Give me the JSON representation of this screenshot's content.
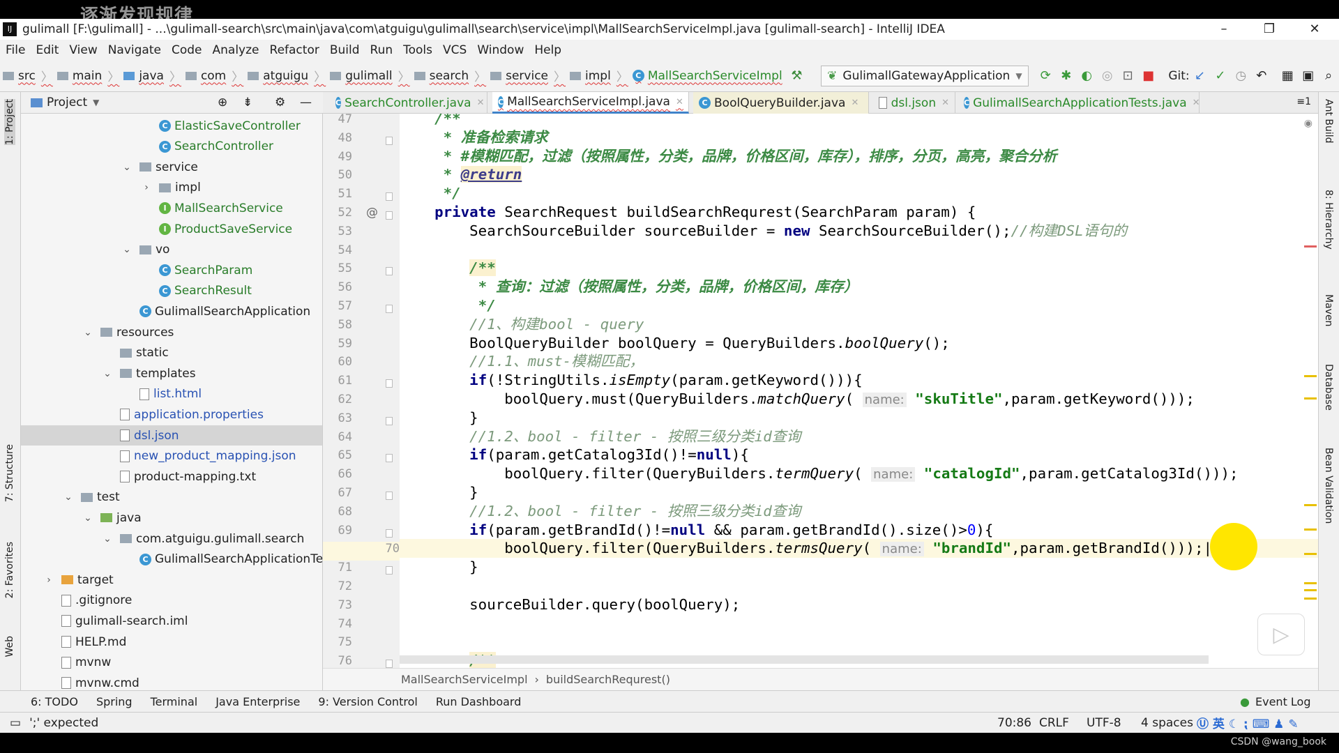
{
  "watermark": "逐渐发现规律",
  "window": {
    "title": "gulimall [F:\\gulimall] - ...\\gulimall-search\\src\\main\\java\\com\\atguigu\\gulimall\\search\\service\\impl\\MallSearchServiceImpl.java [gulimall-search] - IntelliJ IDEA"
  },
  "menu": [
    "File",
    "Edit",
    "View",
    "Navigate",
    "Code",
    "Analyze",
    "Refactor",
    "Build",
    "Run",
    "Tools",
    "VCS",
    "Window",
    "Help"
  ],
  "breadcrumb": [
    "src",
    "main",
    "java",
    "com",
    "atguigu",
    "gulimall",
    "search",
    "service",
    "impl",
    "MallSearchServiceImpl"
  ],
  "toolbar": {
    "run_config": "GulimallGatewayApplication",
    "git_label": "Git:"
  },
  "project_panel": {
    "title": "Project"
  },
  "tree": [
    {
      "level": 5,
      "type": "class",
      "label": "ElasticSaveController"
    },
    {
      "level": 5,
      "type": "class",
      "label": "SearchController"
    },
    {
      "level": 4,
      "type": "folder",
      "arrow": "v",
      "label": "service"
    },
    {
      "level": 5,
      "type": "folder",
      "arrow": ">",
      "label": "impl"
    },
    {
      "level": 5,
      "type": "interface",
      "label": "MallSearchService"
    },
    {
      "level": 5,
      "type": "interface",
      "label": "ProductSaveService"
    },
    {
      "level": 4,
      "type": "folder",
      "arrow": "v",
      "label": "vo"
    },
    {
      "level": 5,
      "type": "class",
      "label": "SearchParam"
    },
    {
      "level": 5,
      "type": "class",
      "label": "SearchResult"
    },
    {
      "level": 4,
      "type": "class",
      "label": "GulimallSearchApplication"
    },
    {
      "level": 2,
      "type": "folder",
      "arrow": "v",
      "label": "resources"
    },
    {
      "level": 3,
      "type": "folder",
      "label": "static"
    },
    {
      "level": 3,
      "type": "folder",
      "arrow": "v",
      "label": "templates"
    },
    {
      "level": 4,
      "type": "file",
      "label": "list.html",
      "color": "blue"
    },
    {
      "level": 3,
      "type": "file",
      "label": "application.properties",
      "color": "blue"
    },
    {
      "level": 3,
      "type": "file",
      "label": "dsl.json",
      "color": "blue",
      "selected": true
    },
    {
      "level": 3,
      "type": "file",
      "label": "new_product_mapping.json",
      "color": "blue"
    },
    {
      "level": 3,
      "type": "file",
      "label": "product-mapping.txt"
    },
    {
      "level": 1,
      "type": "folder",
      "arrow": "v",
      "label": "test"
    },
    {
      "level": 2,
      "type": "folder-green",
      "arrow": "v",
      "label": "java"
    },
    {
      "level": 3,
      "type": "folder",
      "arrow": "v",
      "label": "com.atguigu.gulimall.search"
    },
    {
      "level": 4,
      "type": "class",
      "label": "GulimallSearchApplicationTe"
    },
    {
      "level": 0,
      "type": "folder-orange",
      "arrow": ">",
      "label": "target"
    },
    {
      "level": 0,
      "type": "file",
      "label": ".gitignore"
    },
    {
      "level": 0,
      "type": "file",
      "label": "gulimall-search.iml"
    },
    {
      "level": 0,
      "type": "file",
      "label": "HELP.md"
    },
    {
      "level": 0,
      "type": "file",
      "label": "mvnw"
    },
    {
      "level": 0,
      "type": "file",
      "label": "mvnw.cmd"
    }
  ],
  "tabs": [
    {
      "label": "SearchController.java",
      "active": false
    },
    {
      "label": "MallSearchServiceImpl.java",
      "active": true
    },
    {
      "label": "BoolQueryBuilder.java",
      "active": false
    },
    {
      "label": "dsl.json",
      "active": false
    },
    {
      "label": "GulimallSearchApplicationTests.java",
      "active": false
    }
  ],
  "editor": {
    "first_line": 47,
    "current_line": 70,
    "lines": [
      [
        [
          "d",
          "    /**"
        ]
      ],
      [
        [
          "d",
          "     * 准备检索请求"
        ]
      ],
      [
        [
          "d",
          "     * #模糊匹配，过滤（按照属性，分类，品牌，价格区间，库存），排序，分页，高亮，聚合分析"
        ]
      ],
      [
        [
          "d",
          "     * "
        ],
        [
          "dt",
          "@return"
        ]
      ],
      [
        [
          "d",
          "     */"
        ]
      ],
      [
        [
          "",
          "    "
        ],
        [
          "k",
          "private"
        ],
        [
          "",
          " SearchRequest buildSearchRequrest(SearchParam param) {"
        ]
      ],
      [
        [
          "",
          "        SearchSourceBuilder sourceBuilder = "
        ],
        [
          "k",
          "new"
        ],
        [
          "",
          " SearchSourceBuilder();"
        ],
        [
          "c",
          "//构建DSL语句的"
        ]
      ],
      [],
      [
        [
          "",
          "        "
        ],
        [
          "d hl",
          "/**"
        ]
      ],
      [
        [
          "d",
          "         * 查询：过滤（按照属性，分类，品牌，价格区间，库存）"
        ]
      ],
      [
        [
          "d",
          "         */"
        ]
      ],
      [
        [
          "c",
          "        //1、构建bool - query"
        ]
      ],
      [
        [
          "",
          "        BoolQueryBuilder boolQuery = QueryBuilders."
        ],
        [
          "i",
          "boolQuery"
        ],
        [
          "",
          "();"
        ]
      ],
      [
        [
          "c",
          "        //1.1、must-模糊匹配，"
        ]
      ],
      [
        [
          "",
          "        "
        ],
        [
          "k",
          "if"
        ],
        [
          "",
          "(!StringUtils."
        ],
        [
          "i",
          "isEmpty"
        ],
        [
          "",
          "(param.getKeyword())){"
        ]
      ],
      [
        [
          "",
          "            boolQuery.must(QueryBuilders."
        ],
        [
          "i",
          "matchQuery"
        ],
        [
          "",
          "( "
        ],
        [
          "h",
          "name:"
        ],
        [
          "",
          " "
        ],
        [
          "s",
          "\"skuTitle\""
        ],
        [
          "",
          ",param.getKeyword()));"
        ]
      ],
      [
        [
          "",
          "        }"
        ]
      ],
      [
        [
          "c",
          "        //1.2、bool - filter - 按照三级分类id查询"
        ]
      ],
      [
        [
          "",
          "        "
        ],
        [
          "k",
          "if"
        ],
        [
          "",
          "(param.getCatalog3Id()!="
        ],
        [
          "k",
          "null"
        ],
        [
          "",
          "){"
        ]
      ],
      [
        [
          "",
          "            boolQuery.filter(QueryBuilders."
        ],
        [
          "i",
          "termQuery"
        ],
        [
          "",
          "( "
        ],
        [
          "h",
          "name:"
        ],
        [
          "",
          " "
        ],
        [
          "s",
          "\"catalogId\""
        ],
        [
          "",
          ",param.getCatalog3Id()));"
        ]
      ],
      [
        [
          "",
          "        }"
        ]
      ],
      [
        [
          "c",
          "        //1.2、bool - filter - 按照三级分类id查询"
        ]
      ],
      [
        [
          "",
          "        "
        ],
        [
          "k",
          "if"
        ],
        [
          "",
          "(param.getBrandId()!="
        ],
        [
          "k",
          "null"
        ],
        [
          "",
          " && param.getBrandId().size()>"
        ],
        [
          "n",
          "0"
        ],
        [
          "",
          "){"
        ]
      ],
      [
        [
          "",
          "            boolQuery.filter(QueryBuilders."
        ],
        [
          "i",
          "termsQuery"
        ],
        [
          "",
          "( "
        ],
        [
          "h",
          "name:"
        ],
        [
          "",
          " "
        ],
        [
          "s",
          "\"brandId\""
        ],
        [
          "",
          ",param.getBrandId()));"
        ]
      ],
      [
        [
          "",
          "        }"
        ]
      ],
      [],
      [
        [
          "",
          "        sourceBuilder.query(boolQuery);"
        ]
      ],
      [],
      [],
      [
        [
          "",
          "        "
        ],
        [
          "d hl",
          "/**"
        ]
      ]
    ]
  },
  "editor_breadcrumb": [
    "MallSearchServiceImpl",
    "buildSearchRequrest()"
  ],
  "left_stripe": [
    "1: Project",
    "7: Structure",
    "2: Favorites",
    "Web"
  ],
  "right_stripe": [
    "Ant Build",
    "8: Hierarchy",
    "Maven",
    "Database",
    "Bean Validation"
  ],
  "tool_windows": [
    "6: TODO",
    "Spring",
    "Terminal",
    "Java Enterprise",
    "9: Version Control",
    "Run Dashboard"
  ],
  "event_log": "Event Log",
  "status": {
    "message": "';' expected",
    "position": "70:86",
    "line_sep": "CRLF",
    "encoding": "UTF-8",
    "indent": "4 spaces",
    "ime": "英"
  },
  "credit": "CSDN @wang_book"
}
